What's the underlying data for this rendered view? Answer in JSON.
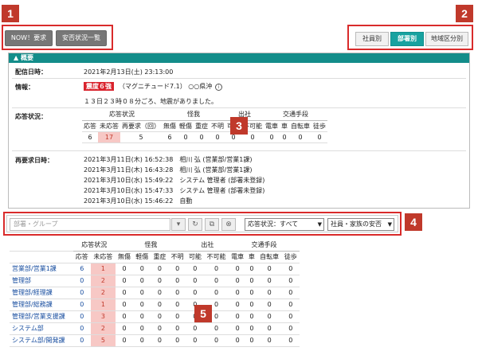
{
  "callouts": [
    "1",
    "2",
    "3",
    "4",
    "5"
  ],
  "toolbar": {
    "request_now": "NOW！要求",
    "safety_list": "安否状況一覧"
  },
  "view_tabs": [
    "社員別",
    "部署別",
    "地域区分別"
  ],
  "panel": {
    "title": "概要",
    "delivered_label": "配信日時：",
    "delivered_value": "2021年2月13日(土) 23:13:00",
    "info_label": "情報：",
    "info_badge": "震度６強",
    "info_text": "（マグニチュード7.1） ○○県沖",
    "info_line2": "１３日２３時０８分ごろ、地震がありました。",
    "response_label": "応答状況：",
    "rerequest_label": "再要求日時：",
    "rerequests": [
      "2021年3月11日(木) 16:52:38　相川 弘 (営業部/営業1課)",
      "2021年3月11日(木) 16:43:28　相川 弘 (営業部/営業1課)",
      "2021年3月10日(水) 15:49:22　システム 管理者 (部署未登録)",
      "2021年3月10日(水) 15:47:33　システム 管理者 (部署未登録)",
      "2021年3月10日(水) 15:46:22　自動"
    ]
  },
  "summary": {
    "groups": [
      "応答状況",
      "怪我",
      "出社",
      "交通手段"
    ],
    "cols": [
      "応答",
      "未応答",
      "再要求（回）",
      "無傷",
      "軽傷",
      "重症",
      "不明",
      "可能",
      "不可能",
      "電車",
      "車",
      "自転車",
      "徒歩"
    ],
    "values": [
      "6",
      "17",
      "5",
      "6",
      "0",
      "0",
      "0",
      "0",
      "0",
      "0",
      "0",
      "0",
      "0"
    ]
  },
  "filter": {
    "group_placeholder": "部署・グループ",
    "status_select": "応答状況：すべて",
    "type_select": "社員・家族の安否"
  },
  "list": {
    "groups": [
      "応答状況",
      "怪我",
      "出社",
      "交通手段"
    ],
    "cols": [
      "応答",
      "未応答",
      "無傷",
      "軽傷",
      "重症",
      "不明",
      "可能",
      "不可能",
      "電車",
      "車",
      "自転車",
      "徒歩"
    ],
    "rows": [
      {
        "name": "営業部/営業1課",
        "values": [
          "6",
          "1",
          "0",
          "0",
          "0",
          "0",
          "0",
          "0",
          "0",
          "0",
          "0",
          "0"
        ]
      },
      {
        "name": "管理部",
        "values": [
          "0",
          "2",
          "0",
          "0",
          "0",
          "0",
          "0",
          "0",
          "0",
          "0",
          "0",
          "0"
        ]
      },
      {
        "name": "管理部/経理課",
        "values": [
          "0",
          "2",
          "0",
          "0",
          "0",
          "0",
          "0",
          "0",
          "0",
          "0",
          "0",
          "0"
        ]
      },
      {
        "name": "管理部/総務課",
        "values": [
          "0",
          "1",
          "0",
          "0",
          "0",
          "0",
          "0",
          "0",
          "0",
          "0",
          "0",
          "0"
        ]
      },
      {
        "name": "管理部/営業支援課",
        "values": [
          "0",
          "3",
          "0",
          "0",
          "0",
          "0",
          "0",
          "0",
          "0",
          "0",
          "0",
          "0"
        ]
      },
      {
        "name": "システム部",
        "values": [
          "0",
          "2",
          "0",
          "0",
          "0",
          "0",
          "0",
          "0",
          "0",
          "0",
          "0",
          "0"
        ]
      },
      {
        "name": "システム部/開発課",
        "values": [
          "0",
          "5",
          "0",
          "0",
          "0",
          "0",
          "0",
          "0",
          "0",
          "0",
          "0",
          "0"
        ]
      }
    ]
  },
  "colors": {
    "accent": "#17a2a0",
    "callout": "#c0392b",
    "highlight": "#f7c8c5",
    "link": "#1a4fa0"
  }
}
